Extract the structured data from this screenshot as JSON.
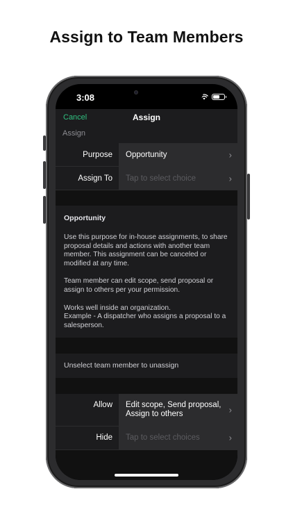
{
  "headline": "Assign to Team Members",
  "status_bar": {
    "time": "3:08"
  },
  "nav": {
    "cancel_label": "Cancel",
    "title": "Assign"
  },
  "section_header": "Assign",
  "assign_rows": [
    {
      "label": "Purpose",
      "value": "Opportunity",
      "is_placeholder": false
    },
    {
      "label": "Assign To",
      "value": "Tap to select choice",
      "is_placeholder": true
    }
  ],
  "info": {
    "title": "Opportunity",
    "paragraph1": "Use this purpose for in-house assignments, to share proposal details and actions with another team member. This assignment can be canceled or modified at any time.",
    "paragraph2": "Team member can edit scope, send proposal or assign to others per your permission.",
    "paragraph3_line1": "Works well inside an organization.",
    "paragraph3_line2": "Example - A dispatcher who assigns a proposal to a salesperson."
  },
  "unselect_text": "Unselect team member to unassign",
  "permission_rows": [
    {
      "label": "Allow",
      "value": "Edit scope, Send proposal, Assign to others",
      "is_placeholder": false
    },
    {
      "label": "Hide",
      "value": "Tap to select choices",
      "is_placeholder": true
    }
  ],
  "colors": {
    "accent": "#30c080",
    "background": "#111111",
    "cell": "#1c1c1e",
    "cell_value": "#2c2c2e"
  },
  "icons": [
    "signal-icon",
    "wifi-icon",
    "battery-icon",
    "chevron-right-icon"
  ]
}
